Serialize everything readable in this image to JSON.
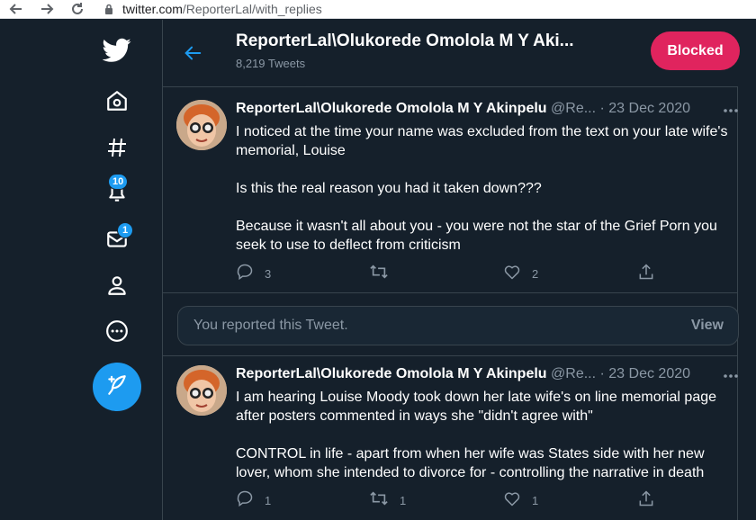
{
  "browser": {
    "url_domain": "twitter.com",
    "url_path": "/ReporterLal/with_replies"
  },
  "sidebar": {
    "notifications_badge": "10",
    "messages_badge": "1"
  },
  "header": {
    "title": "ReporterLal\\Olukorede Omolola M Y Aki...",
    "tweet_count": "8,219 Tweets",
    "blocked_label": "Blocked"
  },
  "tweets": [
    {
      "name": "ReporterLal\\Olukorede Omolola M Y Akinpelu",
      "handle": "@Re...",
      "date": "· 23 Dec 2020",
      "body": "I noticed at the time your name was excluded from the text on your late wife's memorial, Louise\n\nIs this the real reason you had it taken down???\n\nBecause it wasn't all about you - you were not the star of the Grief Porn you seek to use to deflect from criticism",
      "replies": "3",
      "retweets": "",
      "likes": "2"
    },
    {
      "name": "ReporterLal\\Olukorede Omolola M Y Akinpelu",
      "handle": "@Re...",
      "date": "· 23 Dec 2020",
      "body": "I am hearing Louise Moody took down her late wife's on line memorial page after posters commented in ways she \"didn't agree with\"\n\nCONTROL in life - apart from when her wife was States side with her new lover, whom she intended to divorce for - controlling the narrative in death",
      "replies": "1",
      "retweets": "1",
      "likes": "1"
    }
  ],
  "reported": {
    "text": "You reported this Tweet.",
    "view_label": "View"
  },
  "colors": {
    "background": "#15202b",
    "accent": "#1d9bf0",
    "blocked": "#e0245e",
    "secondary_text": "#8b98a5",
    "border": "#38444d"
  }
}
